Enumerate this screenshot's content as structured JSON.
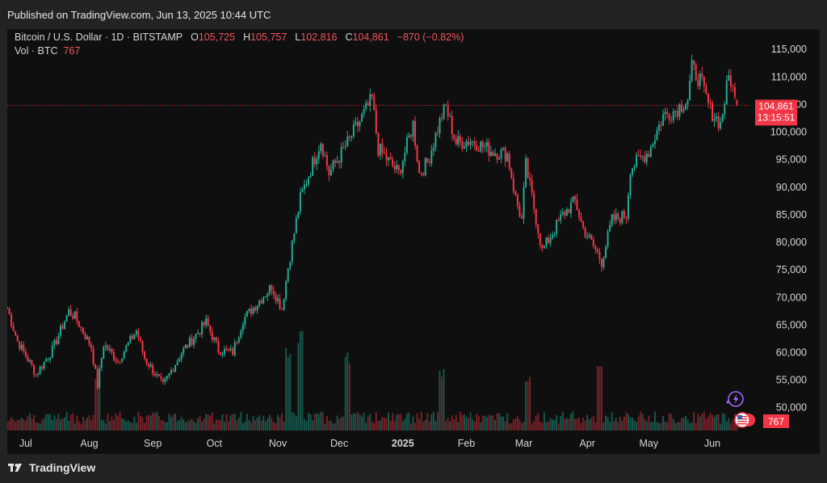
{
  "header": {
    "published": "Published on TradingView.com, Jun 13, 2025 10:44 UTC"
  },
  "footer": {
    "brand": "TradingView"
  },
  "legend": {
    "symbol": "Bitcoin / U.S. Dollar · 1D · BITSTAMP",
    "o_label": "O",
    "o_value": "105,725",
    "h_label": "H",
    "h_value": "105,757",
    "l_label": "L",
    "l_value": "102,816",
    "c_label": "C",
    "c_value": "104,861",
    "change": "−870 (−0.82%)",
    "vol_label": "Vol · BTC",
    "vol_value": "767"
  },
  "price_label": {
    "price": "104,861",
    "countdown": "13:15:51"
  },
  "volume_label": "767",
  "colors": {
    "up": "#22ab94",
    "down": "#f23645",
    "background": "#0f0f0f",
    "frame": "#232323",
    "label_bg": "#f23645"
  },
  "icons": [
    "lightning-icon",
    "us-flag-icon"
  ],
  "chart_data": {
    "type": "candlestick",
    "title": "Bitcoin / U.S. Dollar · 1D · BITSTAMP",
    "y_axis": {
      "position": "right",
      "ylim": [
        46000,
        116500
      ],
      "ticks": [
        50000,
        55000,
        60000,
        65000,
        70000,
        75000,
        80000,
        85000,
        90000,
        95000,
        100000,
        105000,
        110000,
        115000
      ],
      "tick_labels": [
        "50,000",
        "55,000",
        "60,000",
        "65,000",
        "70,000",
        "75,000",
        "80,000",
        "85,000",
        "90,000",
        "95,000",
        "100,000",
        "105,000",
        "110,000",
        "115,000"
      ]
    },
    "x_axis": {
      "range": [
        "2025-06-13 span from 2024-06-22",
        "2025-06-14"
      ],
      "start": "2024-06-22",
      "end": "2025-06-14",
      "ticks": [
        "2024-07-01",
        "2024-08-01",
        "2024-09-01",
        "2024-10-01",
        "2024-11-01",
        "2024-12-01",
        "2025-01-01",
        "2025-02-01",
        "2025-03-01",
        "2025-04-01",
        "2025-05-01",
        "2025-06-01"
      ],
      "tick_labels": [
        "Jul",
        "Aug",
        "Sep",
        "Oct",
        "Nov",
        "Dec",
        "2025",
        "Feb",
        "Mar",
        "Apr",
        "May",
        "Jun"
      ]
    },
    "last_price": 104861,
    "grid": false,
    "close_path": [
      [
        "2024-06-22",
        68000
      ],
      [
        "2024-06-27",
        62000
      ],
      [
        "2024-07-04",
        57500
      ],
      [
        "2024-07-06",
        56000
      ],
      [
        "2024-07-14",
        60500
      ],
      [
        "2024-07-22",
        67500
      ],
      [
        "2024-07-25",
        66500
      ],
      [
        "2024-08-02",
        61000
      ],
      [
        "2024-08-05",
        54000
      ],
      [
        "2024-08-08",
        61500
      ],
      [
        "2024-08-15",
        58500
      ],
      [
        "2024-08-24",
        64000
      ],
      [
        "2024-08-28",
        59000
      ],
      [
        "2024-09-06",
        54000
      ],
      [
        "2024-09-15",
        60000
      ],
      [
        "2024-09-27",
        65500
      ],
      [
        "2024-10-03",
        60500
      ],
      [
        "2024-10-10",
        60000
      ],
      [
        "2024-10-15",
        66000
      ],
      [
        "2024-10-29",
        72000
      ],
      [
        "2024-11-03",
        68000
      ],
      [
        "2024-11-06",
        75500
      ],
      [
        "2024-11-12",
        88000
      ],
      [
        "2024-11-22",
        98500
      ],
      [
        "2024-11-26",
        92500
      ],
      [
        "2024-12-05",
        98000
      ],
      [
        "2024-12-17",
        106000
      ],
      [
        "2024-12-20",
        97000
      ],
      [
        "2024-12-30",
        92500
      ],
      [
        "2025-01-06",
        101500
      ],
      [
        "2025-01-09",
        92500
      ],
      [
        "2025-01-13",
        94500
      ],
      [
        "2025-01-20",
        103000
      ],
      [
        "2025-01-22",
        104500
      ],
      [
        "2025-01-27",
        98000
      ],
      [
        "2025-02-03",
        98500
      ],
      [
        "2025-02-14",
        96500
      ],
      [
        "2025-02-21",
        96000
      ],
      [
        "2025-02-25",
        88000
      ],
      [
        "2025-02-28",
        84000
      ],
      [
        "2025-03-02",
        94000
      ],
      [
        "2025-03-10",
        78500
      ],
      [
        "2025-03-20",
        85000
      ],
      [
        "2025-03-26",
        87500
      ],
      [
        "2025-03-30",
        82500
      ],
      [
        "2025-04-06",
        78000
      ],
      [
        "2025-04-08",
        76500
      ],
      [
        "2025-04-13",
        84000
      ],
      [
        "2025-04-20",
        85000
      ],
      [
        "2025-04-22",
        93500
      ],
      [
        "2025-05-01",
        96500
      ],
      [
        "2025-05-08",
        103000
      ],
      [
        "2025-05-14",
        104000
      ],
      [
        "2025-05-20",
        106000
      ],
      [
        "2025-05-22",
        111500
      ],
      [
        "2025-05-26",
        109500
      ],
      [
        "2025-05-31",
        104000
      ],
      [
        "2025-06-05",
        101500
      ],
      [
        "2025-06-09",
        110000
      ],
      [
        "2025-06-10",
        109500
      ],
      [
        "2025-06-12",
        105700
      ],
      [
        "2025-06-13",
        104861
      ]
    ],
    "volume": {
      "unit": "BTC",
      "last": 767,
      "relative_peaks": [
        [
          "2024-08-05",
          0.55
        ],
        [
          "2024-11-06",
          0.82
        ],
        [
          "2024-11-12",
          1.0
        ],
        [
          "2024-12-05",
          0.78
        ],
        [
          "2025-01-20",
          0.62
        ],
        [
          "2025-03-03",
          0.55
        ],
        [
          "2025-04-07",
          0.7
        ]
      ]
    }
  }
}
